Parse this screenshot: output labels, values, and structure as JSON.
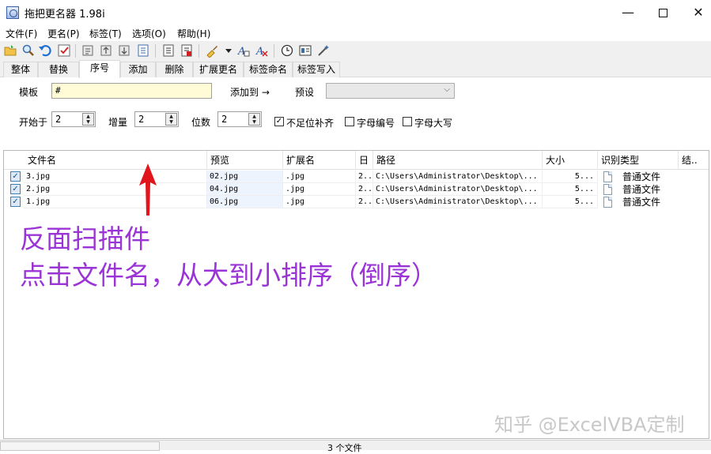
{
  "window": {
    "title": "拖把更名器 1.98i",
    "min_glyph": "—",
    "close_glyph": "✕"
  },
  "menu": [
    "文件(F)",
    "更名(P)",
    "标签(T)",
    "选项(O)",
    "帮助(H)"
  ],
  "tabs": [
    "整体",
    "替换",
    "序号",
    "添加",
    "删除",
    "扩展更名",
    "标签命名",
    "标签写入"
  ],
  "active_tab": "序号",
  "panel": {
    "template_label": "模板",
    "template_value": "#",
    "add_to_label": "添加到 →",
    "preset_label": "预设",
    "preset_value": "",
    "start_label": "开始于",
    "start_value": "2",
    "step_label": "增量",
    "step_value": "2",
    "digits_label": "位数",
    "digits_value": "2",
    "pad_label": "不足位补齐",
    "pad_checked": true,
    "letter_num_label": "字母编号",
    "letter_num_checked": false,
    "upper_label": "字母大写",
    "upper_checked": false
  },
  "grid": {
    "columns": [
      "文件名",
      "预览",
      "扩展名",
      "日",
      "路径",
      "大小",
      "识别类型",
      "结.."
    ],
    "rows": [
      {
        "name": "3.jpg",
        "preview": "02.jpg",
        "ext": ".jpg",
        "date": "2..",
        "path": "C:\\Users\\Administrator\\Desktop\\...",
        "size": "5...",
        "type": "普通文件",
        "checked": true
      },
      {
        "name": "2.jpg",
        "preview": "04.jpg",
        "ext": ".jpg",
        "date": "2..",
        "path": "C:\\Users\\Administrator\\Desktop\\...",
        "size": "5...",
        "type": "普通文件",
        "checked": true
      },
      {
        "name": "1.jpg",
        "preview": "06.jpg",
        "ext": ".jpg",
        "date": "2..",
        "path": "C:\\Users\\Administrator\\Desktop\\...",
        "size": "5...",
        "type": "普通文件",
        "checked": true
      }
    ]
  },
  "annotation": {
    "line1": "反面扫描件",
    "line2": "点击文件名，从大到小排序（倒序）",
    "color": "#9b34d6"
  },
  "watermark": "知乎 @ExcelVBA定制",
  "status": {
    "file_count": "3 个文件"
  },
  "icons": [
    "open-icon",
    "find-icon",
    "undo-icon",
    "check-icon",
    "rename-icon",
    "rename-up-icon",
    "rename-down-icon",
    "doc-icon",
    "page-icon",
    "page-red-icon",
    "brush-icon",
    "dropdown-icon",
    "font-icon",
    "font-clear-icon",
    "clock-icon",
    "panel-icon",
    "wand-icon"
  ],
  "colors": {
    "template_bg": "#fffbd6",
    "preview_bg": "#eef4fd",
    "arrow": "#e0161c"
  }
}
